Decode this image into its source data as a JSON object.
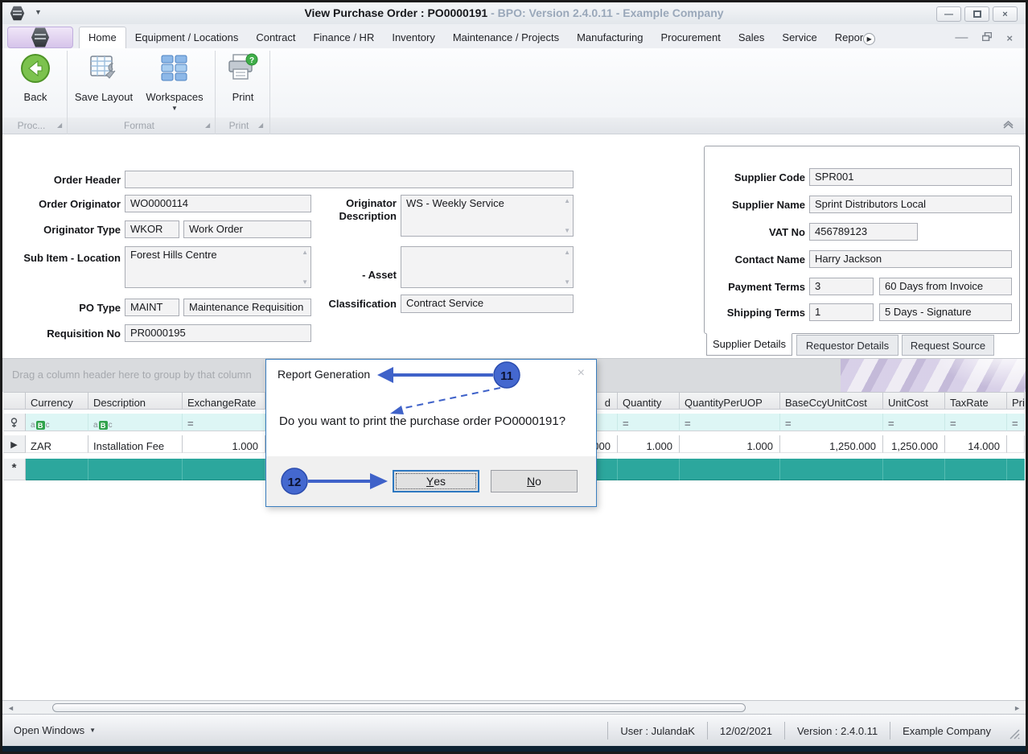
{
  "window": {
    "title_main": "View Purchase Order : PO0000191",
    "title_rest": " - BPO: Version 2.4.0.11 - Example Company"
  },
  "ribbon": {
    "tabs": [
      "Home",
      "Equipment / Locations",
      "Contract",
      "Finance / HR",
      "Inventory",
      "Maintenance / Projects",
      "Manufacturing",
      "Procurement",
      "Sales",
      "Service",
      "Repor"
    ],
    "buttons": {
      "back": "Back",
      "save_layout": "Save Layout",
      "workspaces": "Workspaces",
      "print": "Print"
    },
    "groups": {
      "proc": "Proc...",
      "format": "Format",
      "print": "Print"
    }
  },
  "form": {
    "order_header": {
      "label": "Order Header",
      "value": ""
    },
    "order_originator": {
      "label": "Order Originator",
      "value": "WO0000114"
    },
    "originator_type": {
      "label": "Originator Type",
      "code": "WKOR",
      "desc": "Work Order"
    },
    "sub_item_location": {
      "label": "Sub Item - Location",
      "value": "Forest Hills Centre"
    },
    "po_type": {
      "label": "PO Type",
      "code": "MAINT",
      "desc": "Maintenance Requisition"
    },
    "requisition_no": {
      "label": "Requisition No",
      "value": "PR0000195"
    },
    "originator_description": {
      "label": "Originator Description",
      "value": "WS - Weekly Service"
    },
    "asset": {
      "label": "- Asset",
      "value": ""
    },
    "classification": {
      "label": "Classification",
      "value": "Contract Service"
    }
  },
  "supplier": {
    "supplier_code": {
      "label": "Supplier Code",
      "value": "SPR001"
    },
    "supplier_name": {
      "label": "Supplier Name",
      "value": "Sprint Distributors Local"
    },
    "vat_no": {
      "label": "VAT No",
      "value": "456789123"
    },
    "contact_name": {
      "label": "Contact Name",
      "value": "Harry Jackson"
    },
    "payment_terms": {
      "label": "Payment Terms",
      "code": "3",
      "desc": "60 Days from Invoice"
    },
    "shipping_terms": {
      "label": "Shipping Terms",
      "code": "1",
      "desc": "5 Days - Signature"
    },
    "tabs": [
      "Supplier Details",
      "Requestor Details",
      "Request Source"
    ]
  },
  "grid": {
    "group_hint": "Drag a column header here to group by that column",
    "columns": [
      "Currency",
      "Description",
      "ExchangeRate",
      "d",
      "Quantity",
      "QuantityPerUOP",
      "BaseCcyUnitCost",
      "UnitCost",
      "TaxRate",
      "Pri"
    ],
    "row": [
      "ZAR",
      "Installation Fee",
      "1.000",
      "000",
      "1.000",
      "1.000",
      "1,250.000",
      "1,250.000",
      "14.000",
      ""
    ]
  },
  "dialog": {
    "title": "Report Generation",
    "message": "Do you want to print the purchase order PO0000191?",
    "yes": {
      "key": "Y",
      "rest": "es"
    },
    "no": {
      "key": "N",
      "rest": "o"
    }
  },
  "annotations": {
    "n11": "11",
    "n12": "12"
  },
  "statusbar": {
    "open_windows": "Open Windows",
    "user": "User : JulandaK",
    "date": "12/02/2021",
    "version": "Version : 2.4.0.11",
    "company": "Example Company"
  },
  "icons": {
    "caret_down": "▼",
    "caret_up": "▲",
    "minimize": "—",
    "close": "×",
    "row_arrow": "▶",
    "new_row_asterisk": "*",
    "left_arrow": "◄",
    "right_arrow": "►",
    "equals": "=",
    "abc_a": "a",
    "abc_b": "B",
    "abc_c": "c",
    "tab_scroll": "▶",
    "group_corner": "◢"
  },
  "colors": {
    "annotation_blue": "#3f62c9",
    "new_row_teal": "#2ca79d",
    "dialog_border": "#3a7ebf",
    "app_button_lavender": "#d6c4ea",
    "back_green": "#69b93c",
    "filter_row_cyan": "#ddf6f5"
  }
}
